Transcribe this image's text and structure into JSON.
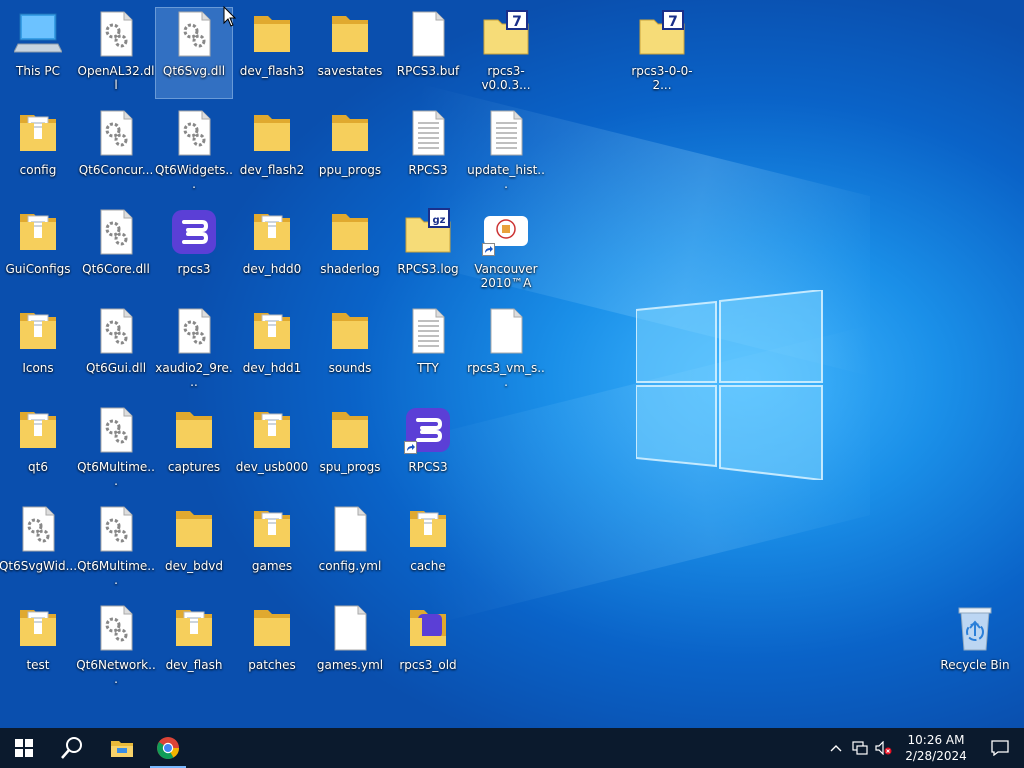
{
  "desktop": {
    "icons": [
      {
        "label": "This PC",
        "type": "pc"
      },
      {
        "label": "OpenAL32.dll",
        "type": "dll"
      },
      {
        "label": "Qt6Svg.dll",
        "type": "dll",
        "selected": true
      },
      {
        "label": "dev_flash3",
        "type": "folder"
      },
      {
        "label": "savestates",
        "type": "folder"
      },
      {
        "label": "RPCS3.buf",
        "type": "file"
      },
      {
        "label": "rpcs3-v0.0.3...",
        "type": "archive7z"
      },
      {
        "label": "rpcs3-0-0-2...",
        "type": "archive7z"
      },
      {
        "label": "config",
        "type": "folder-doc"
      },
      {
        "label": "Qt6Concur...",
        "type": "dll"
      },
      {
        "label": "Qt6Widgets...",
        "type": "dll"
      },
      {
        "label": "dev_flash2",
        "type": "folder"
      },
      {
        "label": "ppu_progs",
        "type": "folder"
      },
      {
        "label": "RPCS3",
        "type": "text"
      },
      {
        "label": "update_hist...",
        "type": "text"
      },
      {
        "label": "GuiConfigs",
        "type": "folder-doc"
      },
      {
        "label": "Qt6Core.dll",
        "type": "dll"
      },
      {
        "label": "rpcs3",
        "type": "rpcs3"
      },
      {
        "label": "dev_hdd0",
        "type": "folder-doc"
      },
      {
        "label": "shaderlog",
        "type": "folder"
      },
      {
        "label": "RPCS3.log",
        "type": "archivegz"
      },
      {
        "label": "Vancouver 2010™A",
        "type": "game-shortcut"
      },
      {
        "label": "Icons",
        "type": "folder-doc"
      },
      {
        "label": "Qt6Gui.dll",
        "type": "dll"
      },
      {
        "label": "xaudio2_9re...",
        "type": "dll"
      },
      {
        "label": "dev_hdd1",
        "type": "folder-doc"
      },
      {
        "label": "sounds",
        "type": "folder"
      },
      {
        "label": "TTY",
        "type": "text"
      },
      {
        "label": "rpcs3_vm_s...",
        "type": "file"
      },
      {
        "label": "qt6",
        "type": "folder-doc"
      },
      {
        "label": "Qt6Multime...",
        "type": "dll"
      },
      {
        "label": "captures",
        "type": "folder"
      },
      {
        "label": "dev_usb000",
        "type": "folder-doc"
      },
      {
        "label": "spu_progs",
        "type": "folder"
      },
      {
        "label": "RPCS3",
        "type": "rpcs3-shortcut"
      },
      {
        "label": "Qt6SvgWid...",
        "type": "dll"
      },
      {
        "label": "Qt6Multime...",
        "type": "dll"
      },
      {
        "label": "dev_bdvd",
        "type": "folder"
      },
      {
        "label": "games",
        "type": "folder-doc"
      },
      {
        "label": "config.yml",
        "type": "file"
      },
      {
        "label": "cache",
        "type": "folder-doc"
      },
      {
        "label": "test",
        "type": "folder-doc"
      },
      {
        "label": "Qt6Network...",
        "type": "dll"
      },
      {
        "label": "dev_flash",
        "type": "folder-doc"
      },
      {
        "label": "patches",
        "type": "folder"
      },
      {
        "label": "games.yml",
        "type": "file"
      },
      {
        "label": "rpcs3_old",
        "type": "folder-rpcs3"
      },
      {
        "label": "Recycle Bin",
        "type": "recycle"
      }
    ]
  },
  "taskbar": {
    "clock_time": "10:26 AM",
    "clock_date": "2/28/2024"
  },
  "colors": {
    "taskbar": "#0b1a2d",
    "folder": "#f4cd5a",
    "rpcs3": "#5b3fd6"
  }
}
